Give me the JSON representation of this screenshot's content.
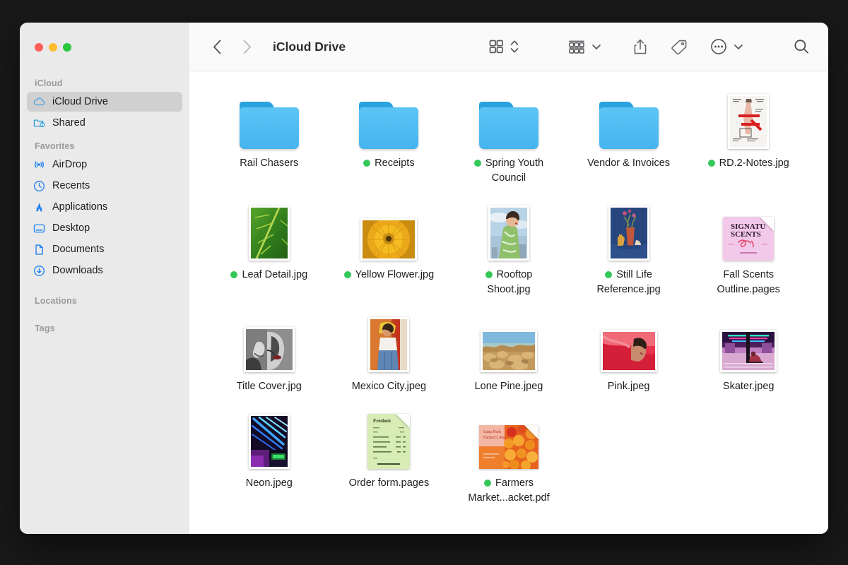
{
  "window": {
    "title": "iCloud Drive",
    "traffic_lights": [
      {
        "name": "close",
        "color": "#ff5f57"
      },
      {
        "name": "minimize",
        "color": "#febc2e"
      },
      {
        "name": "zoom",
        "color": "#28c840"
      }
    ]
  },
  "toolbar": {
    "back_label": "Back",
    "forward_label": "Forward",
    "path_title": "iCloud Drive",
    "view_mode": "icon-view",
    "group_by": "group-by",
    "share_label": "Share",
    "tag_label": "Tags",
    "more_label": "More",
    "search_label": "Search"
  },
  "sidebar": {
    "sections": [
      {
        "title": "iCloud",
        "items": [
          {
            "label": "iCloud Drive",
            "icon": "cloud-icon",
            "selected": true
          },
          {
            "label": "Shared",
            "icon": "shared-folder-icon",
            "selected": false
          }
        ]
      },
      {
        "title": "Favorites",
        "items": [
          {
            "label": "AirDrop",
            "icon": "airdrop-icon",
            "selected": false
          },
          {
            "label": "Recents",
            "icon": "clock-icon",
            "selected": false
          },
          {
            "label": "Applications",
            "icon": "applications-icon",
            "selected": false
          },
          {
            "label": "Desktop",
            "icon": "desktop-icon",
            "selected": false
          },
          {
            "label": "Documents",
            "icon": "document-icon",
            "selected": false
          },
          {
            "label": "Downloads",
            "icon": "download-icon",
            "selected": false
          }
        ]
      },
      {
        "title": "Locations",
        "items": []
      },
      {
        "title": "Tags",
        "items": []
      }
    ]
  },
  "colors": {
    "tag_green": "#34c759",
    "sidebar_bg": "#eaeaea",
    "selection": "#d0d0d0",
    "accent_blue": "#1a7ff0",
    "folder_blue": "#4fbcf2"
  },
  "files": [
    {
      "name": "Rail Chasers",
      "kind": "folder",
      "tag": null
    },
    {
      "name": "Receipts",
      "kind": "folder",
      "tag": null
    },
    {
      "name": "Spring Youth Council",
      "kind": "folder",
      "tag": "green"
    },
    {
      "name": "Vendor & Invoices",
      "kind": "folder",
      "tag": null
    },
    {
      "name": "RD.2-Notes.jpg",
      "kind": "image-notes",
      "tag": "green"
    },
    {
      "name": "Leaf Detail.jpg",
      "kind": "image-leaf",
      "tag": "green"
    },
    {
      "name": "Yellow Flower.jpg",
      "kind": "image-flower",
      "tag": "green"
    },
    {
      "name": "Rooftop Shoot.jpg",
      "kind": "image-rooftop",
      "tag": "green"
    },
    {
      "name": "Still Life Reference.jpg",
      "kind": "image-stilllife",
      "tag": "green"
    },
    {
      "name": "Fall Scents Outline.pages",
      "kind": "pages-pink",
      "tag": null
    },
    {
      "name": "Title Cover.jpg",
      "kind": "image-titlecover",
      "tag": null
    },
    {
      "name": "Mexico City.jpeg",
      "kind": "image-mexico",
      "tag": null
    },
    {
      "name": "Lone Pine.jpeg",
      "kind": "image-lonepine",
      "tag": null
    },
    {
      "name": "Pink.jpeg",
      "kind": "image-pink",
      "tag": null
    },
    {
      "name": "Skater.jpeg",
      "kind": "image-skater",
      "tag": null
    },
    {
      "name": "Neon.jpeg",
      "kind": "image-neon",
      "tag": null
    },
    {
      "name": "Order form.pages",
      "kind": "pages-green",
      "tag": null
    },
    {
      "name": "Farmers Market...acket.pdf",
      "kind": "pdf-orange",
      "tag": "green"
    }
  ],
  "thumb_text": {
    "fall_scents_line1": "SIGNATU",
    "fall_scents_line2": "SCENTS",
    "farmers_line1": "Luna Park",
    "farmers_line2": "Farmer's Market"
  }
}
